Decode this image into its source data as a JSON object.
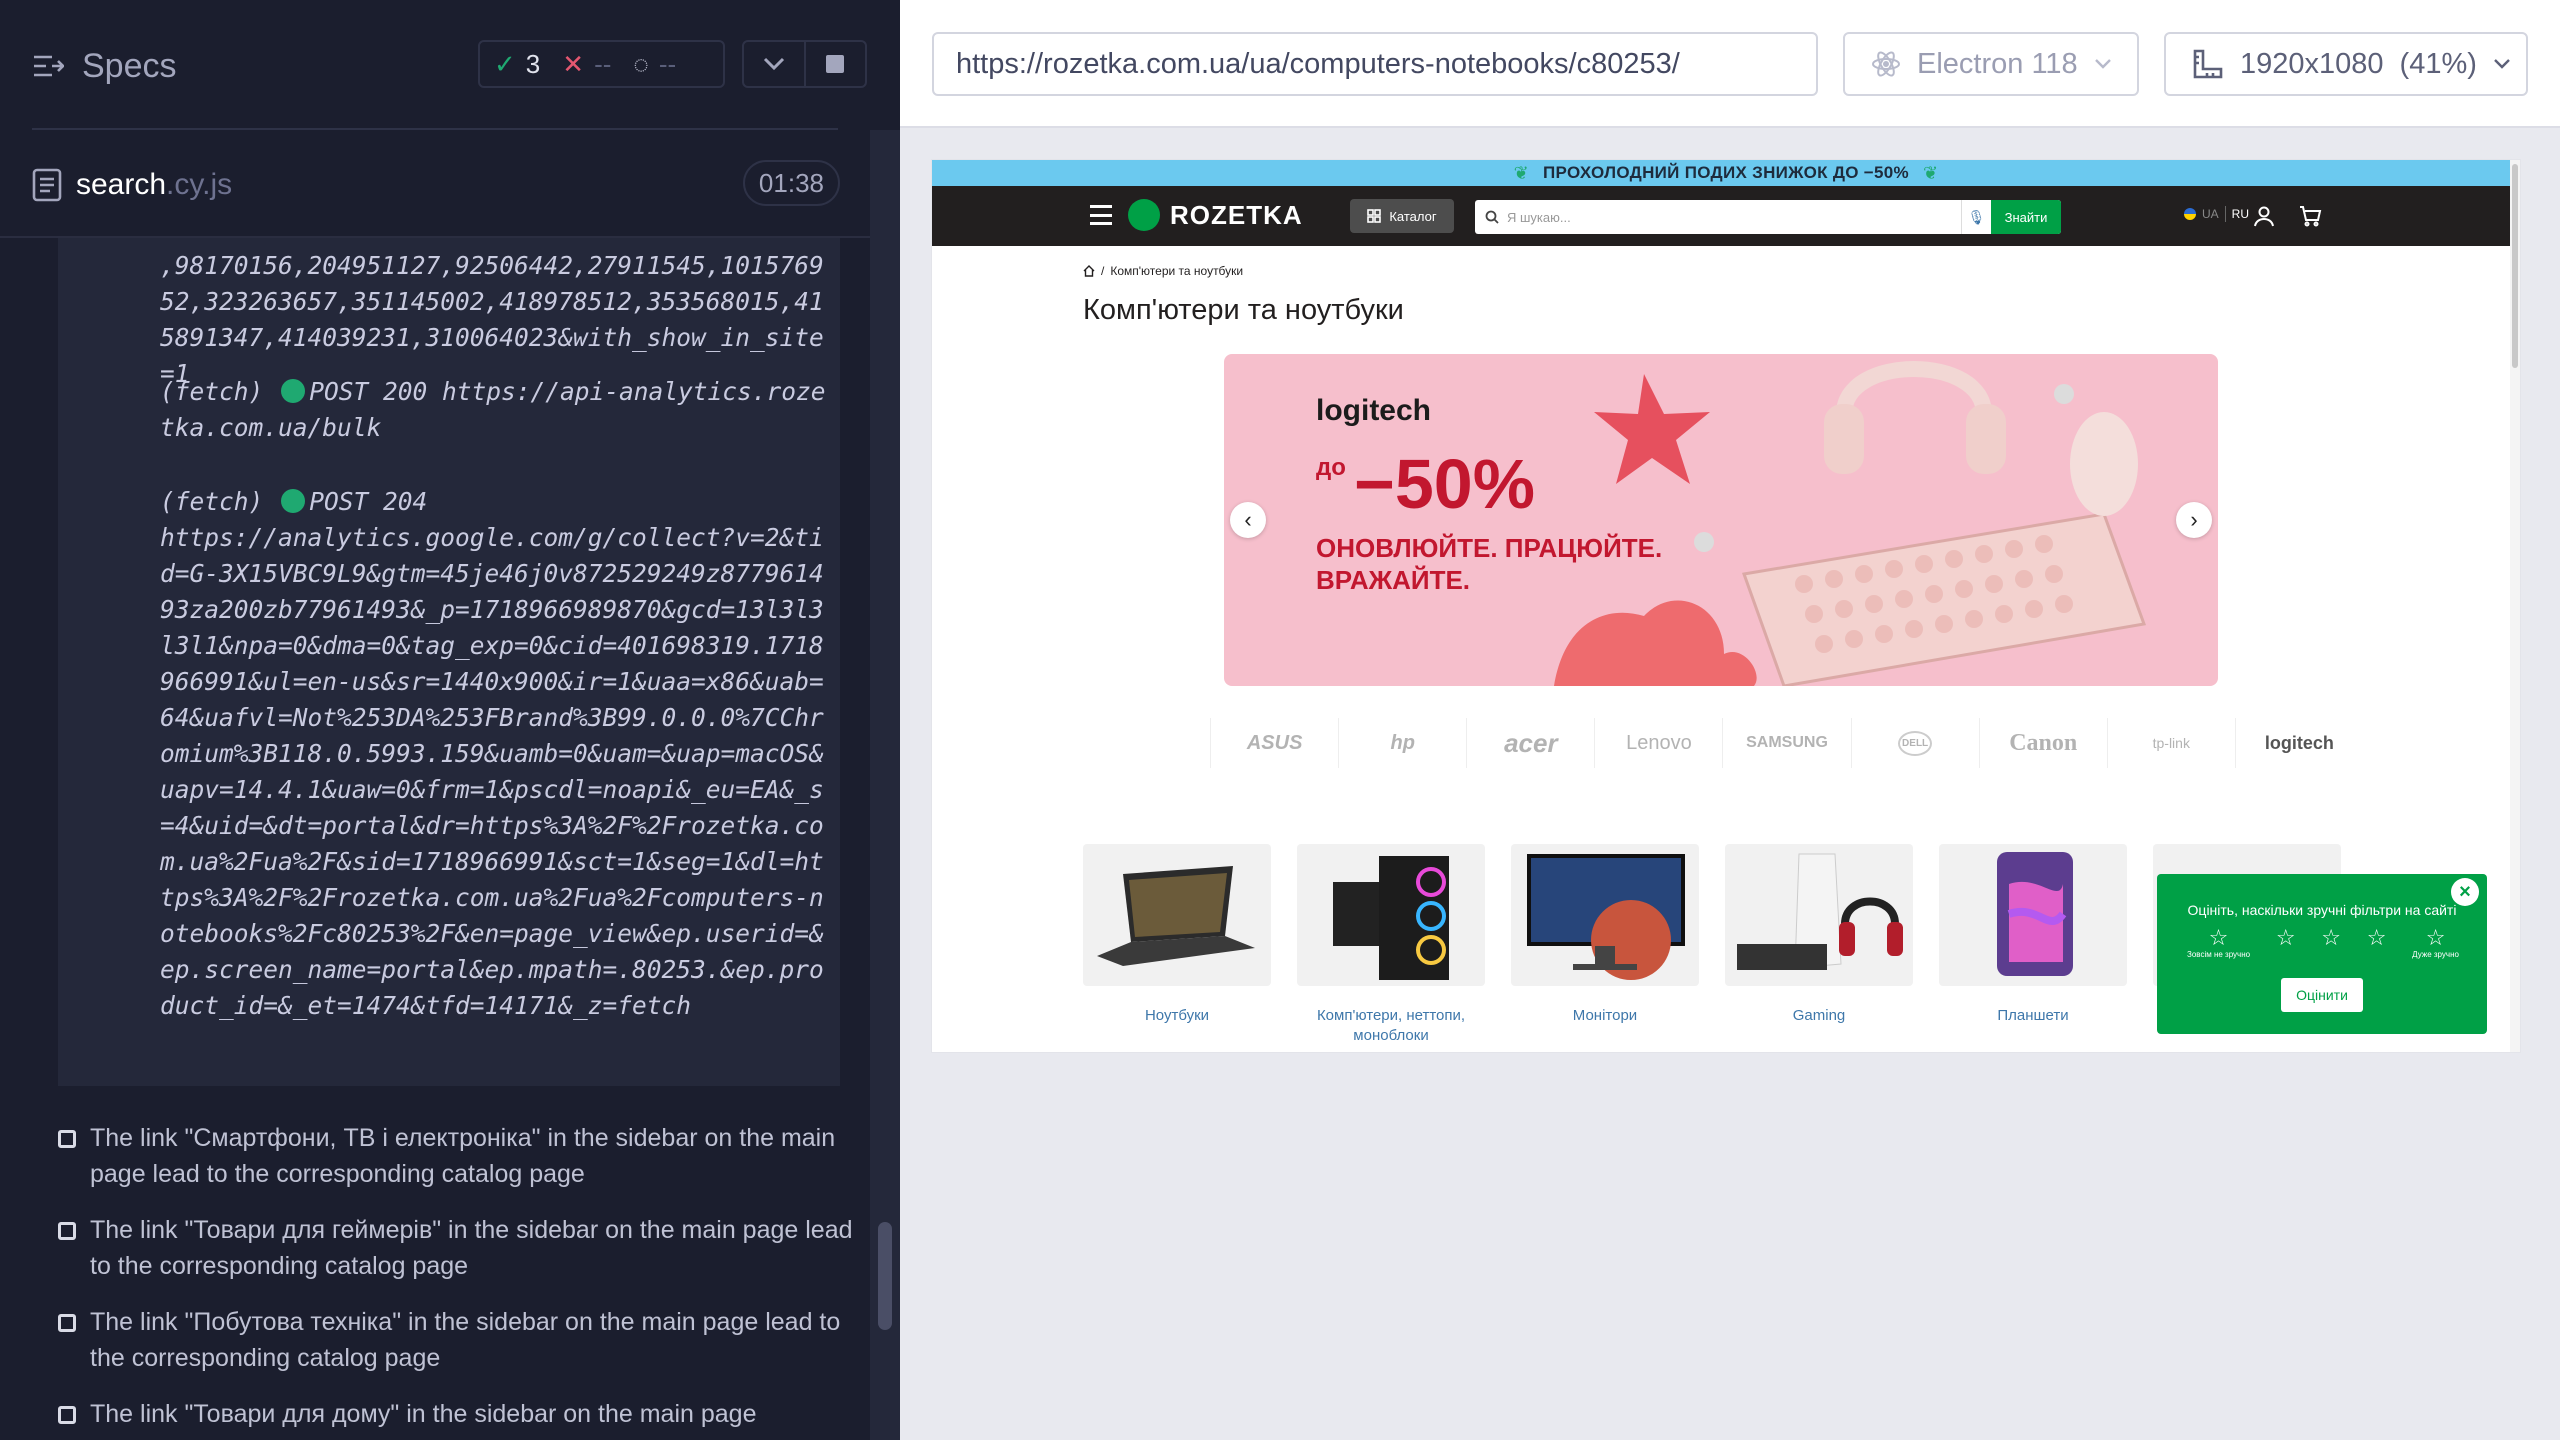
{
  "specs": {
    "title": "Specs",
    "stats": {
      "passed": "3",
      "failed": "--",
      "pending": "--"
    },
    "file": {
      "name": "search",
      "ext": ".cy.js",
      "duration": "01:38"
    }
  },
  "log": [
    {
      "label": "",
      "text": ",98170156,204951127,92506442,27911545,101576952,323263657,351145002,418978512,353568015,415891347,414039231,310064023&with_show_in_site=1"
    },
    {
      "label": "(fetch)",
      "method": "POST 200",
      "text": "https://api-analytics.rozetka.com.ua/bulk"
    },
    {
      "label": "(fetch)",
      "method": "POST 204",
      "text": "https://analytics.google.com/g/collect?v=2&tid=G-3X15VBC9L9&gtm=45je46j0v872529249z877961493za200zb77961493&_p=1718966989870&gcd=13l3l3l3l1&npa=0&dma=0&tag_exp=0&cid=401698319.1718966991&ul=en-us&sr=1440x900&ir=1&uaa=x86&uab=64&uafvl=Not%253DA%253FBrand%3B99.0.0.0%7CChromium%3B118.0.5993.159&uamb=0&uam=&uap=macOS&uapv=14.4.1&uaw=0&frm=1&pscdl=noapi&_eu=EA&_s=4&uid=&dt=portal&dr=https%3A%2F%2Frozetka.com.ua%2Fua%2F&sid=1718966991&sct=1&seg=1&dl=https%3A%2F%2Frozetka.com.ua%2Fua%2Fcomputers-notebooks%2Fc80253%2F&en=page_view&ep.userid=&ep.screen_name=portal&ep.mpath=.80253.&ep.product_id=&_et=1474&tfd=14171&_z=fetch"
    }
  ],
  "tests": [
    "The link \"Смартфони, ТВ і електроніка\" in the sidebar on the main page lead to the corresponding catalog page",
    "The link \"Товари для геймерів\" in the sidebar on the main page lead to the corresponding catalog page",
    "The link \"Побутова техніка\" in the sidebar on the main page lead to the corresponding catalog page",
    "The link \"Товари для дому\" in the sidebar on the main page"
  ],
  "browser": {
    "url": "https://rozetka.com.ua/ua/computers-notebooks/c80253/",
    "engine": "Electron 118",
    "viewport": "1920x1080",
    "scale": "(41%)"
  },
  "aut": {
    "promo": "ПРОХОЛОДНИЙ ПОДИХ ЗНИЖОК ДО −50%",
    "logo": "ROZETKA",
    "catalog": "Каталог",
    "search_placeholder": "Я шукаю...",
    "search_button": "Знайти",
    "lang_ua": "UA",
    "lang_ru": "RU",
    "breadcrumb": "Комп'ютери та ноутбуки",
    "title": "Комп'ютери та ноутбуки",
    "banner": {
      "brand": "logitech",
      "pre": "до",
      "discount": "−50%",
      "tagline": "ОНОВЛЮЙТЕ. ПРАЦЮЙТЕ. ВРАЖАЙТЕ."
    },
    "brands": [
      "",
      "ASUS",
      "hp",
      "acer",
      "Lenovo",
      "SAMSUNG",
      "DELL",
      "Canon",
      "tp-link",
      "logitech"
    ],
    "categories": [
      "Ноутбуки",
      "Комп'ютери, неттопи, моноблоки",
      "Монітори",
      "Gaming",
      "Планшети"
    ],
    "rating": {
      "question": "Оцініть, наскільки зручні фільтри на сайті",
      "low": "Зовсім не зручно",
      "high": "Дуже зручно",
      "button": "Оцінити"
    }
  }
}
